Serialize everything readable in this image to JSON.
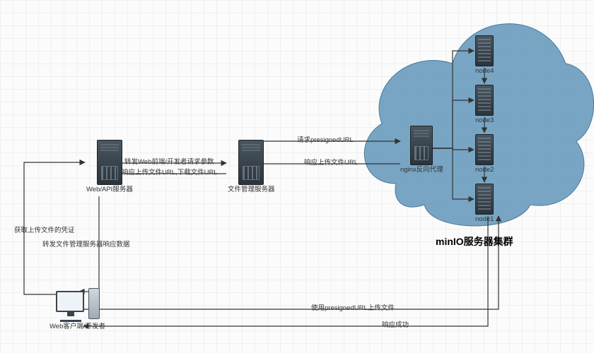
{
  "chart_data": {
    "type": "diagram",
    "title": "minIO服务器集群",
    "nodes": [
      {
        "id": "client",
        "label": "Web客户端/开发者"
      },
      {
        "id": "webapi",
        "label": "Web/API服务器"
      },
      {
        "id": "filemgr",
        "label": "文件管理服务器"
      },
      {
        "id": "nginx",
        "label": "nginx反向代理"
      },
      {
        "id": "node1",
        "label": "node1"
      },
      {
        "id": "node2",
        "label": "node2"
      },
      {
        "id": "node3",
        "label": "node3"
      },
      {
        "id": "node4",
        "label": "node4"
      }
    ],
    "edges": [
      {
        "from": "client",
        "to": "webapi",
        "label": "获取上传文件的凭证"
      },
      {
        "from": "webapi",
        "to": "client",
        "label": "转发文件管理服务器响应数据"
      },
      {
        "from": "webapi",
        "to": "filemgr",
        "label": "转发Web前端/开发者请求参数"
      },
      {
        "from": "filemgr",
        "to": "webapi",
        "label": "响应上传文件URL,下载文件URL"
      },
      {
        "from": "filemgr",
        "to": "nginx",
        "label": "请求presignedURL"
      },
      {
        "from": "nginx",
        "to": "filemgr",
        "label": "响应上传文件URL"
      },
      {
        "from": "nginx",
        "to": "node1",
        "label": ""
      },
      {
        "from": "nginx",
        "to": "node2",
        "label": ""
      },
      {
        "from": "nginx",
        "to": "node3",
        "label": ""
      },
      {
        "from": "nginx",
        "to": "node4",
        "label": ""
      },
      {
        "from": "client",
        "to": "node1",
        "label": "使用presignedURL上传文件"
      },
      {
        "from": "node1",
        "to": "client",
        "label": "响应成功"
      }
    ],
    "cluster": {
      "label": "minIO服务器集群",
      "members": [
        "nginx",
        "node1",
        "node2",
        "node3",
        "node4"
      ]
    }
  },
  "nodes": {
    "client": {
      "label": "Web客户端/开发者"
    },
    "webapi": {
      "label": "Web/API服务器"
    },
    "filemgr": {
      "label": "文件管理服务器"
    },
    "nginx": {
      "label": "nginx反向代理"
    },
    "node1": {
      "label": "node1"
    },
    "node2": {
      "label": "node2"
    },
    "node3": {
      "label": "node3"
    },
    "node4": {
      "label": "node4"
    }
  },
  "edges": {
    "client_to_webapi": "获取上传文件的凭证",
    "webapi_to_client": "转发文件管理服务器响应数据",
    "webapi_to_filemgr": "转发Web前端/开发者请求参数",
    "filemgr_to_webapi": "响应上传文件URL,下载文件URL",
    "filemgr_to_nginx": "请求presignedURL",
    "nginx_to_filemgr": "响应上传文件URL",
    "client_to_node1": "使用presignedURL上传文件",
    "node1_to_client": "响应成功"
  },
  "cluster_label": "minIO服务器集群"
}
